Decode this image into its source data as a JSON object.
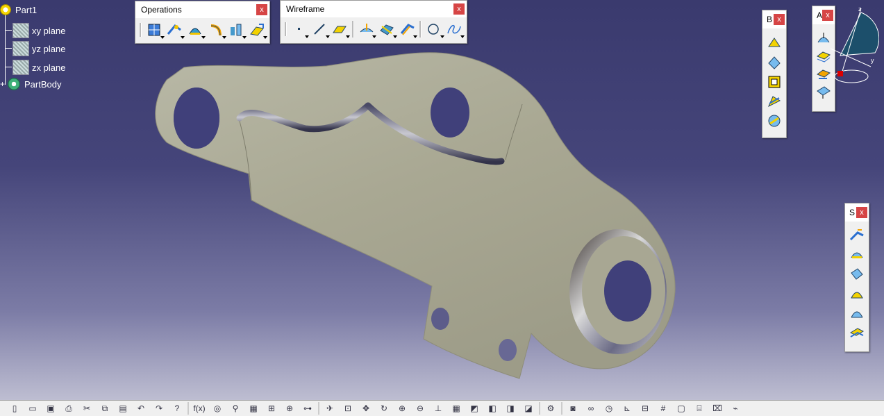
{
  "tree": {
    "root_label": "Part1",
    "items": [
      {
        "label": "xy plane"
      },
      {
        "label": "yz plane"
      },
      {
        "label": "zx plane"
      },
      {
        "label": "PartBody"
      }
    ]
  },
  "toolbars": {
    "operations": {
      "title": "Operations",
      "close": "x"
    },
    "wireframe": {
      "title": "Wireframe",
      "close": "x"
    },
    "b": {
      "title": "B",
      "close": "x"
    },
    "a": {
      "title": "A",
      "close": "x"
    },
    "s": {
      "title": "S",
      "close": "x"
    }
  },
  "compass": {
    "axis_z": "z",
    "axis_y": "y"
  },
  "colors": {
    "background_top": "#3a3a6e",
    "background_bottom": "#c9c9d9",
    "part_surface": "#a9a893",
    "close_red": "#d64545"
  },
  "bottom_toolbar": {
    "fx_label": "f(x)"
  }
}
